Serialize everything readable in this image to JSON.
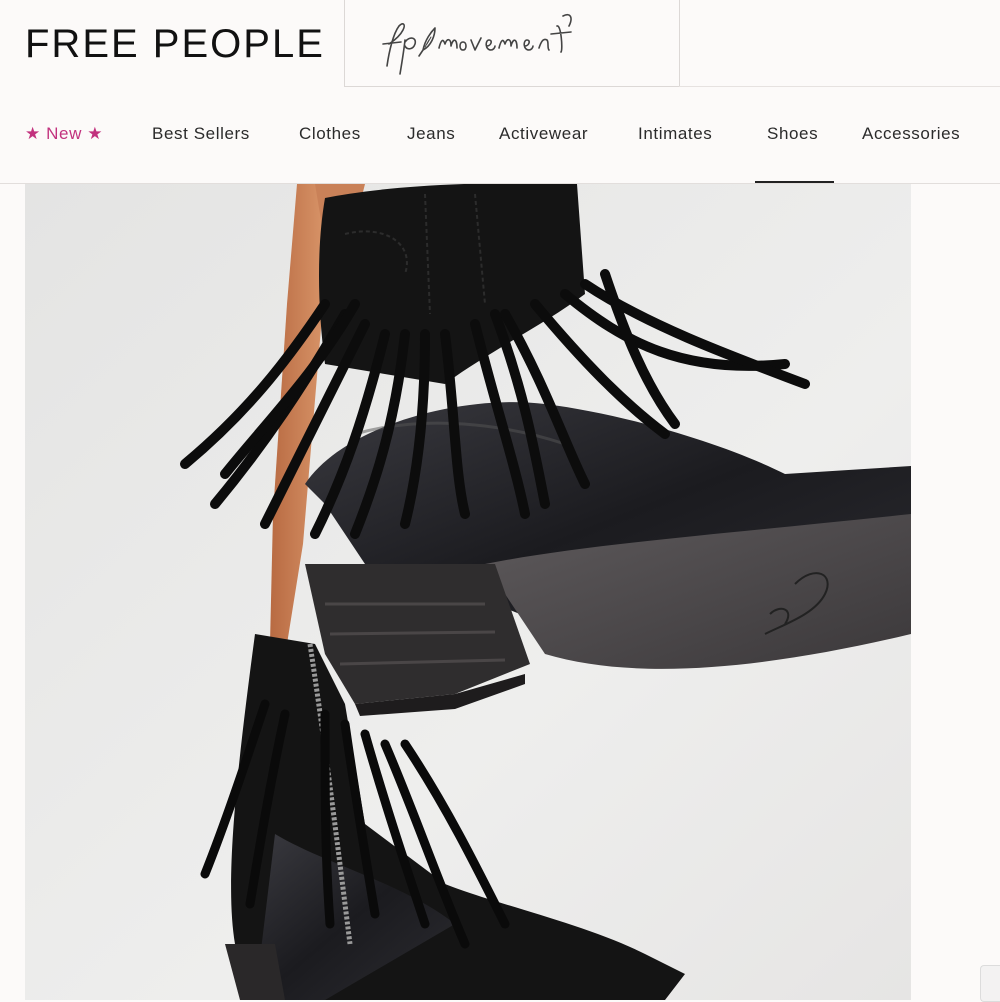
{
  "header": {
    "brand": "FREE PEOPLE",
    "sub_brand": "fp movement"
  },
  "nav": {
    "items": [
      {
        "label": "★ New ★",
        "active": false
      },
      {
        "label": "Best Sellers",
        "active": false
      },
      {
        "label": "Clothes",
        "active": false
      },
      {
        "label": "Jeans",
        "active": false
      },
      {
        "label": "Activewear",
        "active": false
      },
      {
        "label": "Intimates",
        "active": false
      },
      {
        "label": "Shoes",
        "active": true
      },
      {
        "label": "Accessories",
        "active": false
      }
    ]
  },
  "hero": {
    "image_icon": "product-photo-fringe-boots"
  },
  "colors": {
    "accent_new": "#c2327e",
    "text": "#2b2b2b",
    "background": "#fcfaf9"
  }
}
